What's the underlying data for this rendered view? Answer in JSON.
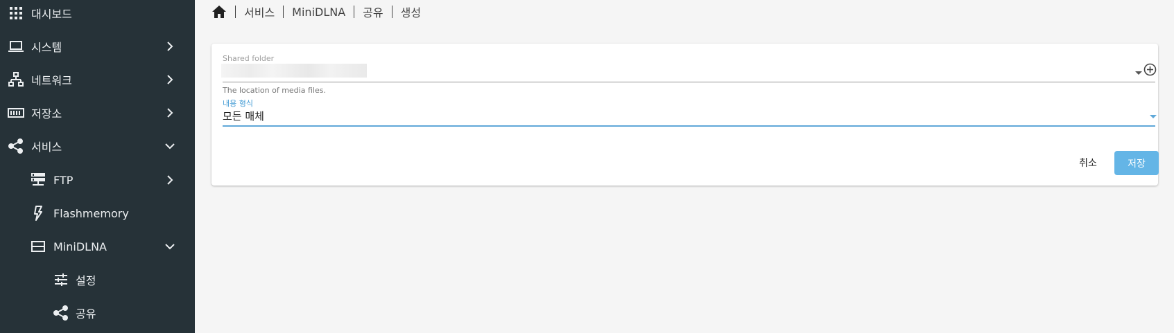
{
  "sidebar": {
    "items": [
      {
        "label": "대시보드",
        "icon": "apps-grid-icon"
      },
      {
        "label": "시스템",
        "icon": "laptop-icon"
      },
      {
        "label": "네트워크",
        "icon": "network-icon"
      },
      {
        "label": "저장소",
        "icon": "storage-icon"
      },
      {
        "label": "서비스",
        "icon": "share-icon"
      },
      {
        "label": "FTP",
        "icon": "server-icon"
      },
      {
        "label": "Flashmemory",
        "icon": "flash-icon"
      },
      {
        "label": "MiniDLNA",
        "icon": "view-agenda-icon"
      },
      {
        "label": "설정",
        "icon": "tune-icon"
      },
      {
        "label": "공유",
        "icon": "share-icon"
      }
    ]
  },
  "breadcrumb": {
    "home_icon": "home-icon",
    "crumbs": [
      "서비스",
      "MiniDLNA",
      "공유",
      "생성"
    ]
  },
  "form": {
    "shared_folder": {
      "label": "Shared folder",
      "hint": "The location of media files.",
      "add_icon": "add-circle-icon"
    },
    "content_type": {
      "label": "내용 형식",
      "value": "모든 매체"
    },
    "cancel_label": "취소",
    "save_label": "저장"
  },
  "colors": {
    "sidebar_bg": "#263238",
    "accent": "#5fa8d8",
    "save_button": "#64b5e6",
    "page_bg": "#f5f5f5"
  }
}
